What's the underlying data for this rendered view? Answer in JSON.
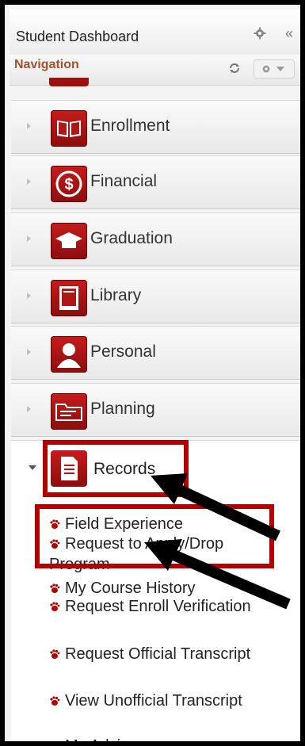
{
  "header": {
    "title": "Student Dashboard",
    "collapse_label": "«"
  },
  "navigation": {
    "title": "Navigation"
  },
  "nav_items": [
    {
      "label": "Enrollment",
      "icon": "book-icon"
    },
    {
      "label": "Financial",
      "icon": "dollar-icon"
    },
    {
      "label": "Graduation",
      "icon": "graduation-cap-icon"
    },
    {
      "label": "Library",
      "icon": "library-book-icon"
    },
    {
      "label": "Personal",
      "icon": "person-icon"
    },
    {
      "label": "Planning",
      "icon": "planning-folder-icon"
    }
  ],
  "records": {
    "label": "Records",
    "icon": "document-icon",
    "sub_items": [
      "Field Experience",
      "Request to Apply/Drop Program",
      "My Course History",
      "Request Enroll Verification",
      "Request Official Transcript",
      "View Unofficial Transcript",
      "My Advisors"
    ]
  },
  "colors": {
    "accent": "#b30000",
    "icon_red": "#a81212",
    "nav_title": "#a0522d"
  }
}
